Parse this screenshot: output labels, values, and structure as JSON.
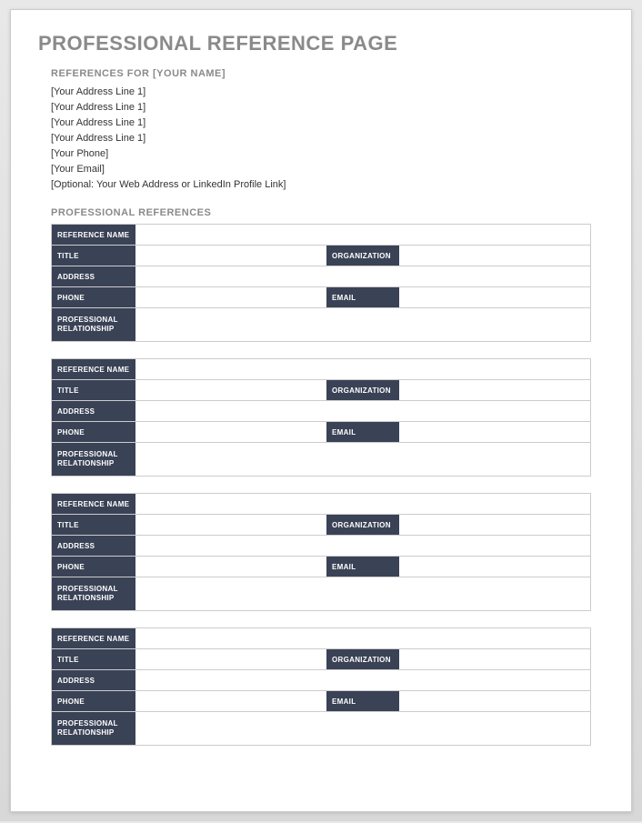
{
  "title": "PROFESSIONAL REFERENCE PAGE",
  "subheader": "REFERENCES FOR [YOUR NAME]",
  "contact": [
    "[Your Address Line 1]",
    "[Your Address Line 1]",
    "[Your Address Line 1]",
    "[Your Address Line 1]",
    "[Your Phone]",
    "[Your Email]",
    "[Optional: Your Web Address or LinkedIn Profile Link]"
  ],
  "section_header": "PROFESSIONAL REFERENCES",
  "labels": {
    "reference_name": "REFERENCE NAME",
    "title": "TITLE",
    "organization": "ORGANIZATION",
    "address": "ADDRESS",
    "phone": "PHONE",
    "email": "EMAIL",
    "relationship": "PROFESSIONAL RELATIONSHIP"
  },
  "references": [
    {
      "name": "",
      "title": "",
      "organization": "",
      "address": "",
      "phone": "",
      "email": "",
      "relationship": ""
    },
    {
      "name": "",
      "title": "",
      "organization": "",
      "address": "",
      "phone": "",
      "email": "",
      "relationship": ""
    },
    {
      "name": "",
      "title": "",
      "organization": "",
      "address": "",
      "phone": "",
      "email": "",
      "relationship": ""
    },
    {
      "name": "",
      "title": "",
      "organization": "",
      "address": "",
      "phone": "",
      "email": "",
      "relationship": ""
    }
  ]
}
